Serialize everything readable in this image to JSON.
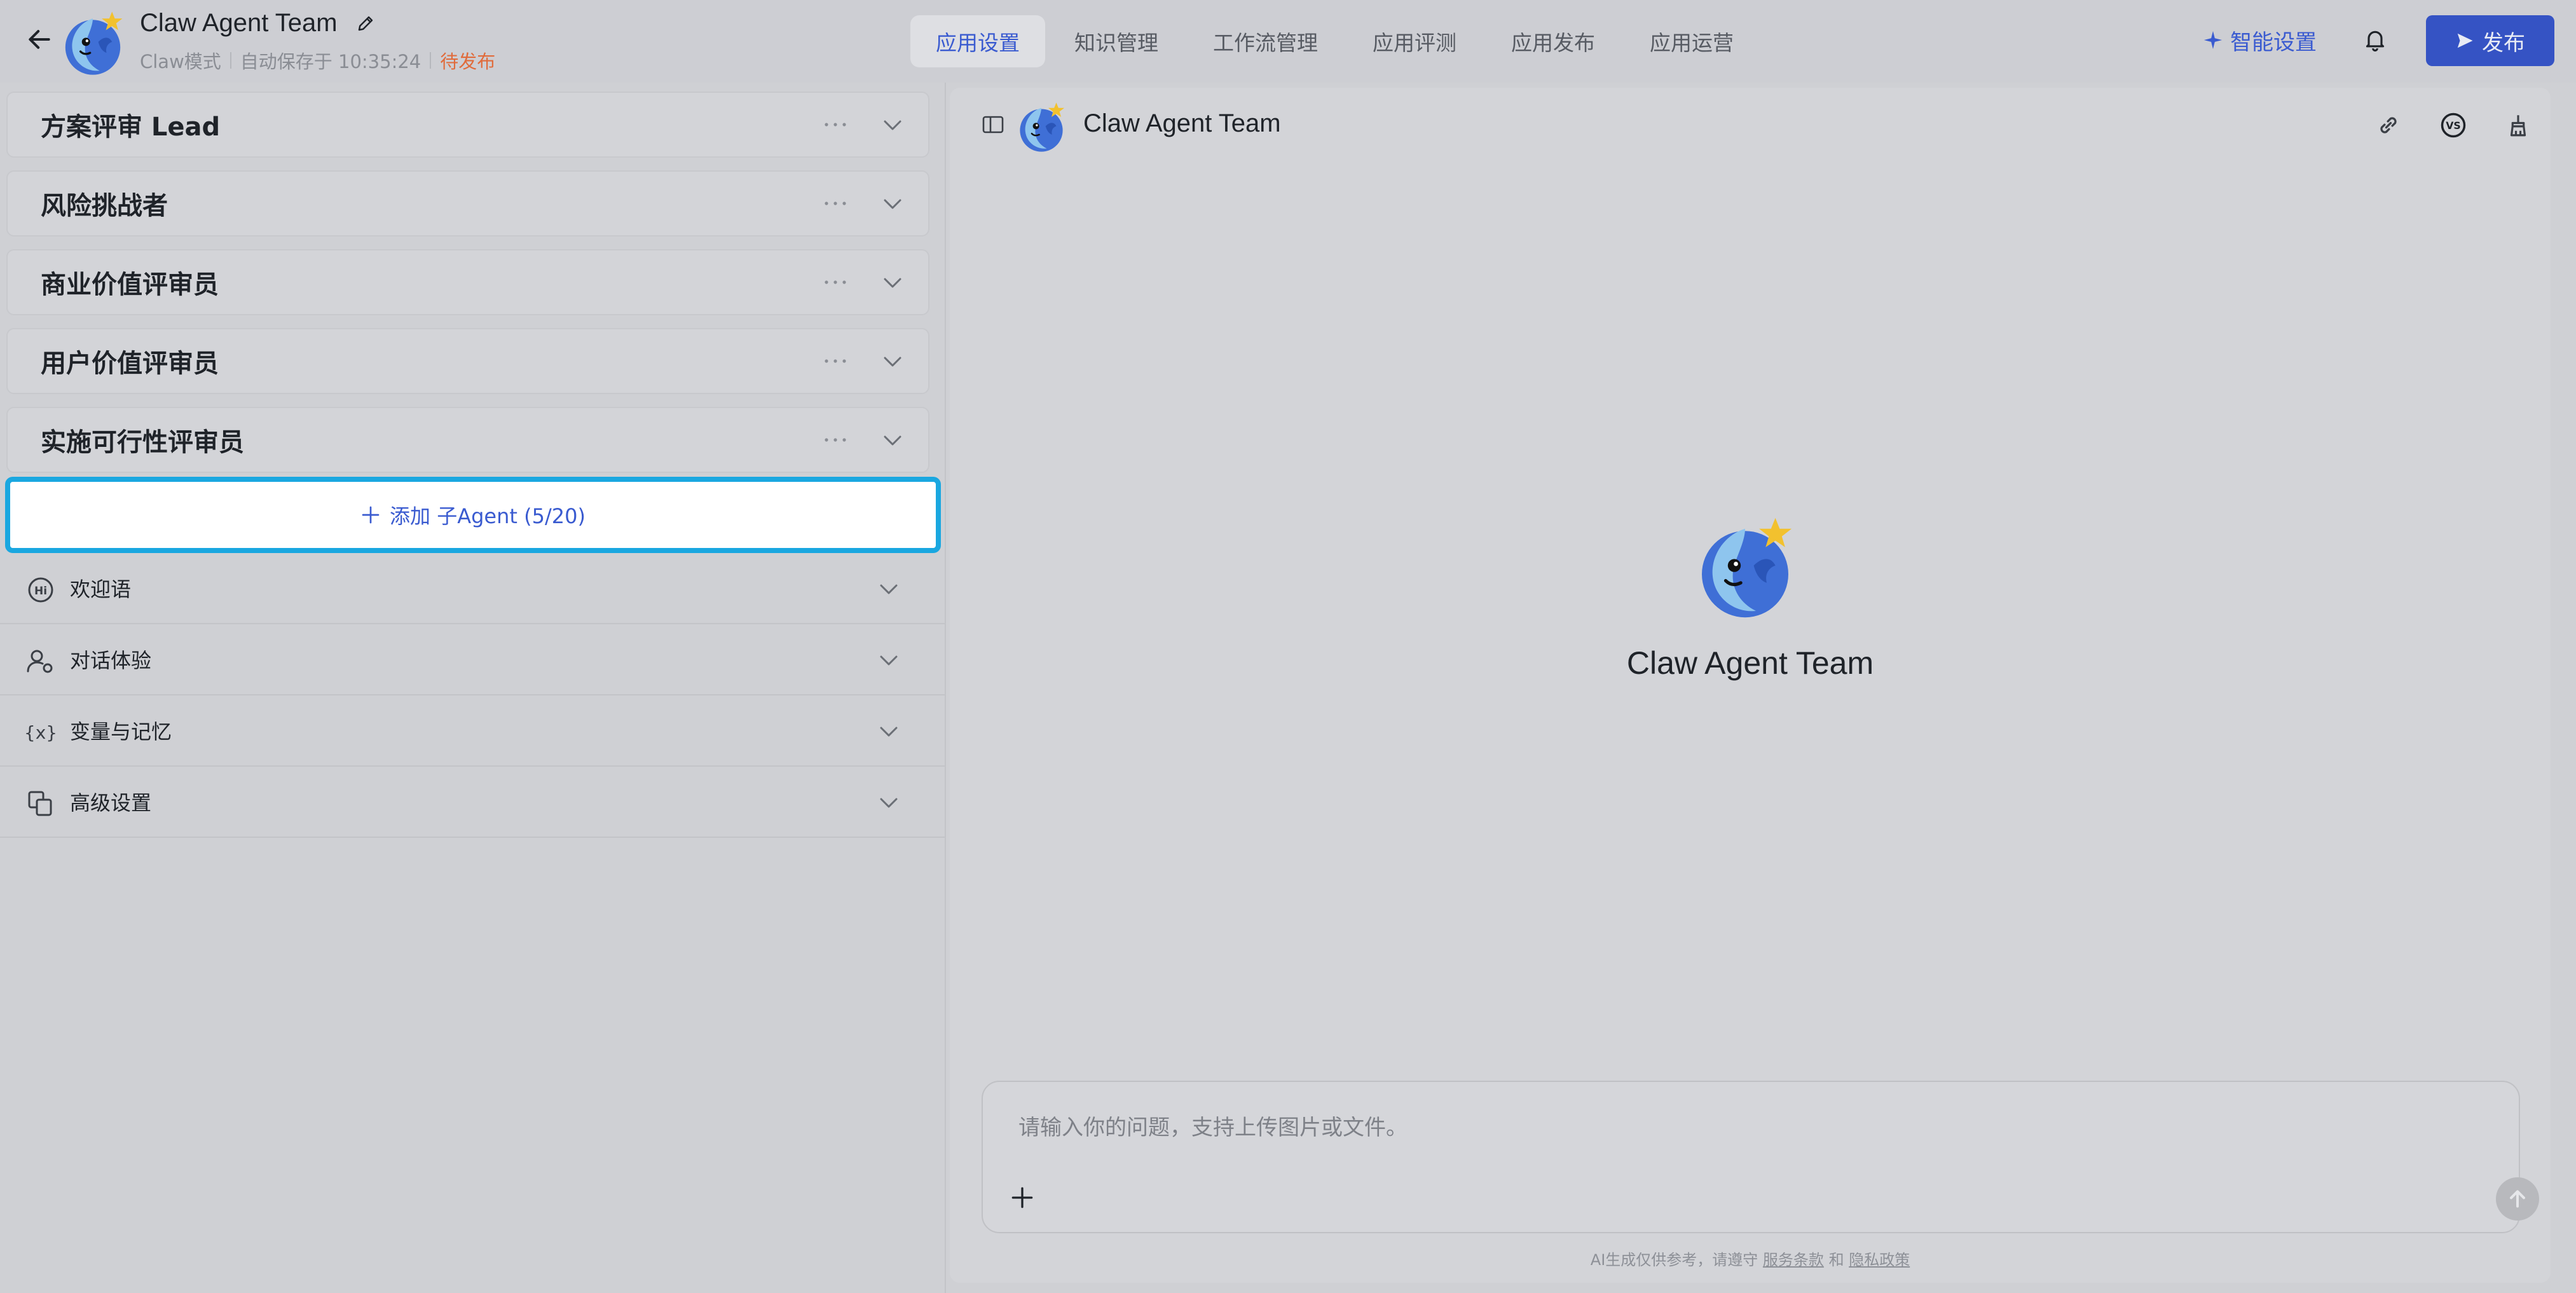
{
  "header": {
    "title": "Claw Agent Team",
    "mode": "Claw模式",
    "autosave": "自动保存于 10:35:24",
    "status": "待发布",
    "tabs": [
      {
        "label": "应用设置",
        "active": true
      },
      {
        "label": "知识管理",
        "active": false
      },
      {
        "label": "工作流管理",
        "active": false
      },
      {
        "label": "应用评测",
        "active": false
      },
      {
        "label": "应用发布",
        "active": false
      },
      {
        "label": "应用运营",
        "active": false
      }
    ],
    "smart_settings": "智能设置",
    "publish": "发布"
  },
  "agents": [
    {
      "name": "方案评审 Lead"
    },
    {
      "name": "风险挑战者"
    },
    {
      "name": "商业价值评审员"
    },
    {
      "name": "用户价值评审员"
    },
    {
      "name": "实施可行性评审员"
    }
  ],
  "add_agent": "添加 子Agent (5/20)",
  "sections": [
    {
      "label": "欢迎语",
      "icon": "hi-icon"
    },
    {
      "label": "对话体验",
      "icon": "user-settings-icon"
    },
    {
      "label": "变量与记忆",
      "icon": "variable-icon"
    },
    {
      "label": "高级设置",
      "icon": "copy-icon"
    }
  ],
  "preview": {
    "title": "Claw Agent Team",
    "center_title": "Claw Agent Team",
    "input_placeholder": "请输入你的问题，支持上传图片或文件。",
    "footer_prefix": "AI生成仅供参考，请遵守",
    "footer_terms": "服务条款",
    "footer_and": "和",
    "footer_privacy": "隐私政策"
  },
  "colors": {
    "accent": "#3a5bd0",
    "pending": "#e06b3b",
    "highlight_border": "#1aa7e0",
    "publish_button": "#3553c4"
  }
}
